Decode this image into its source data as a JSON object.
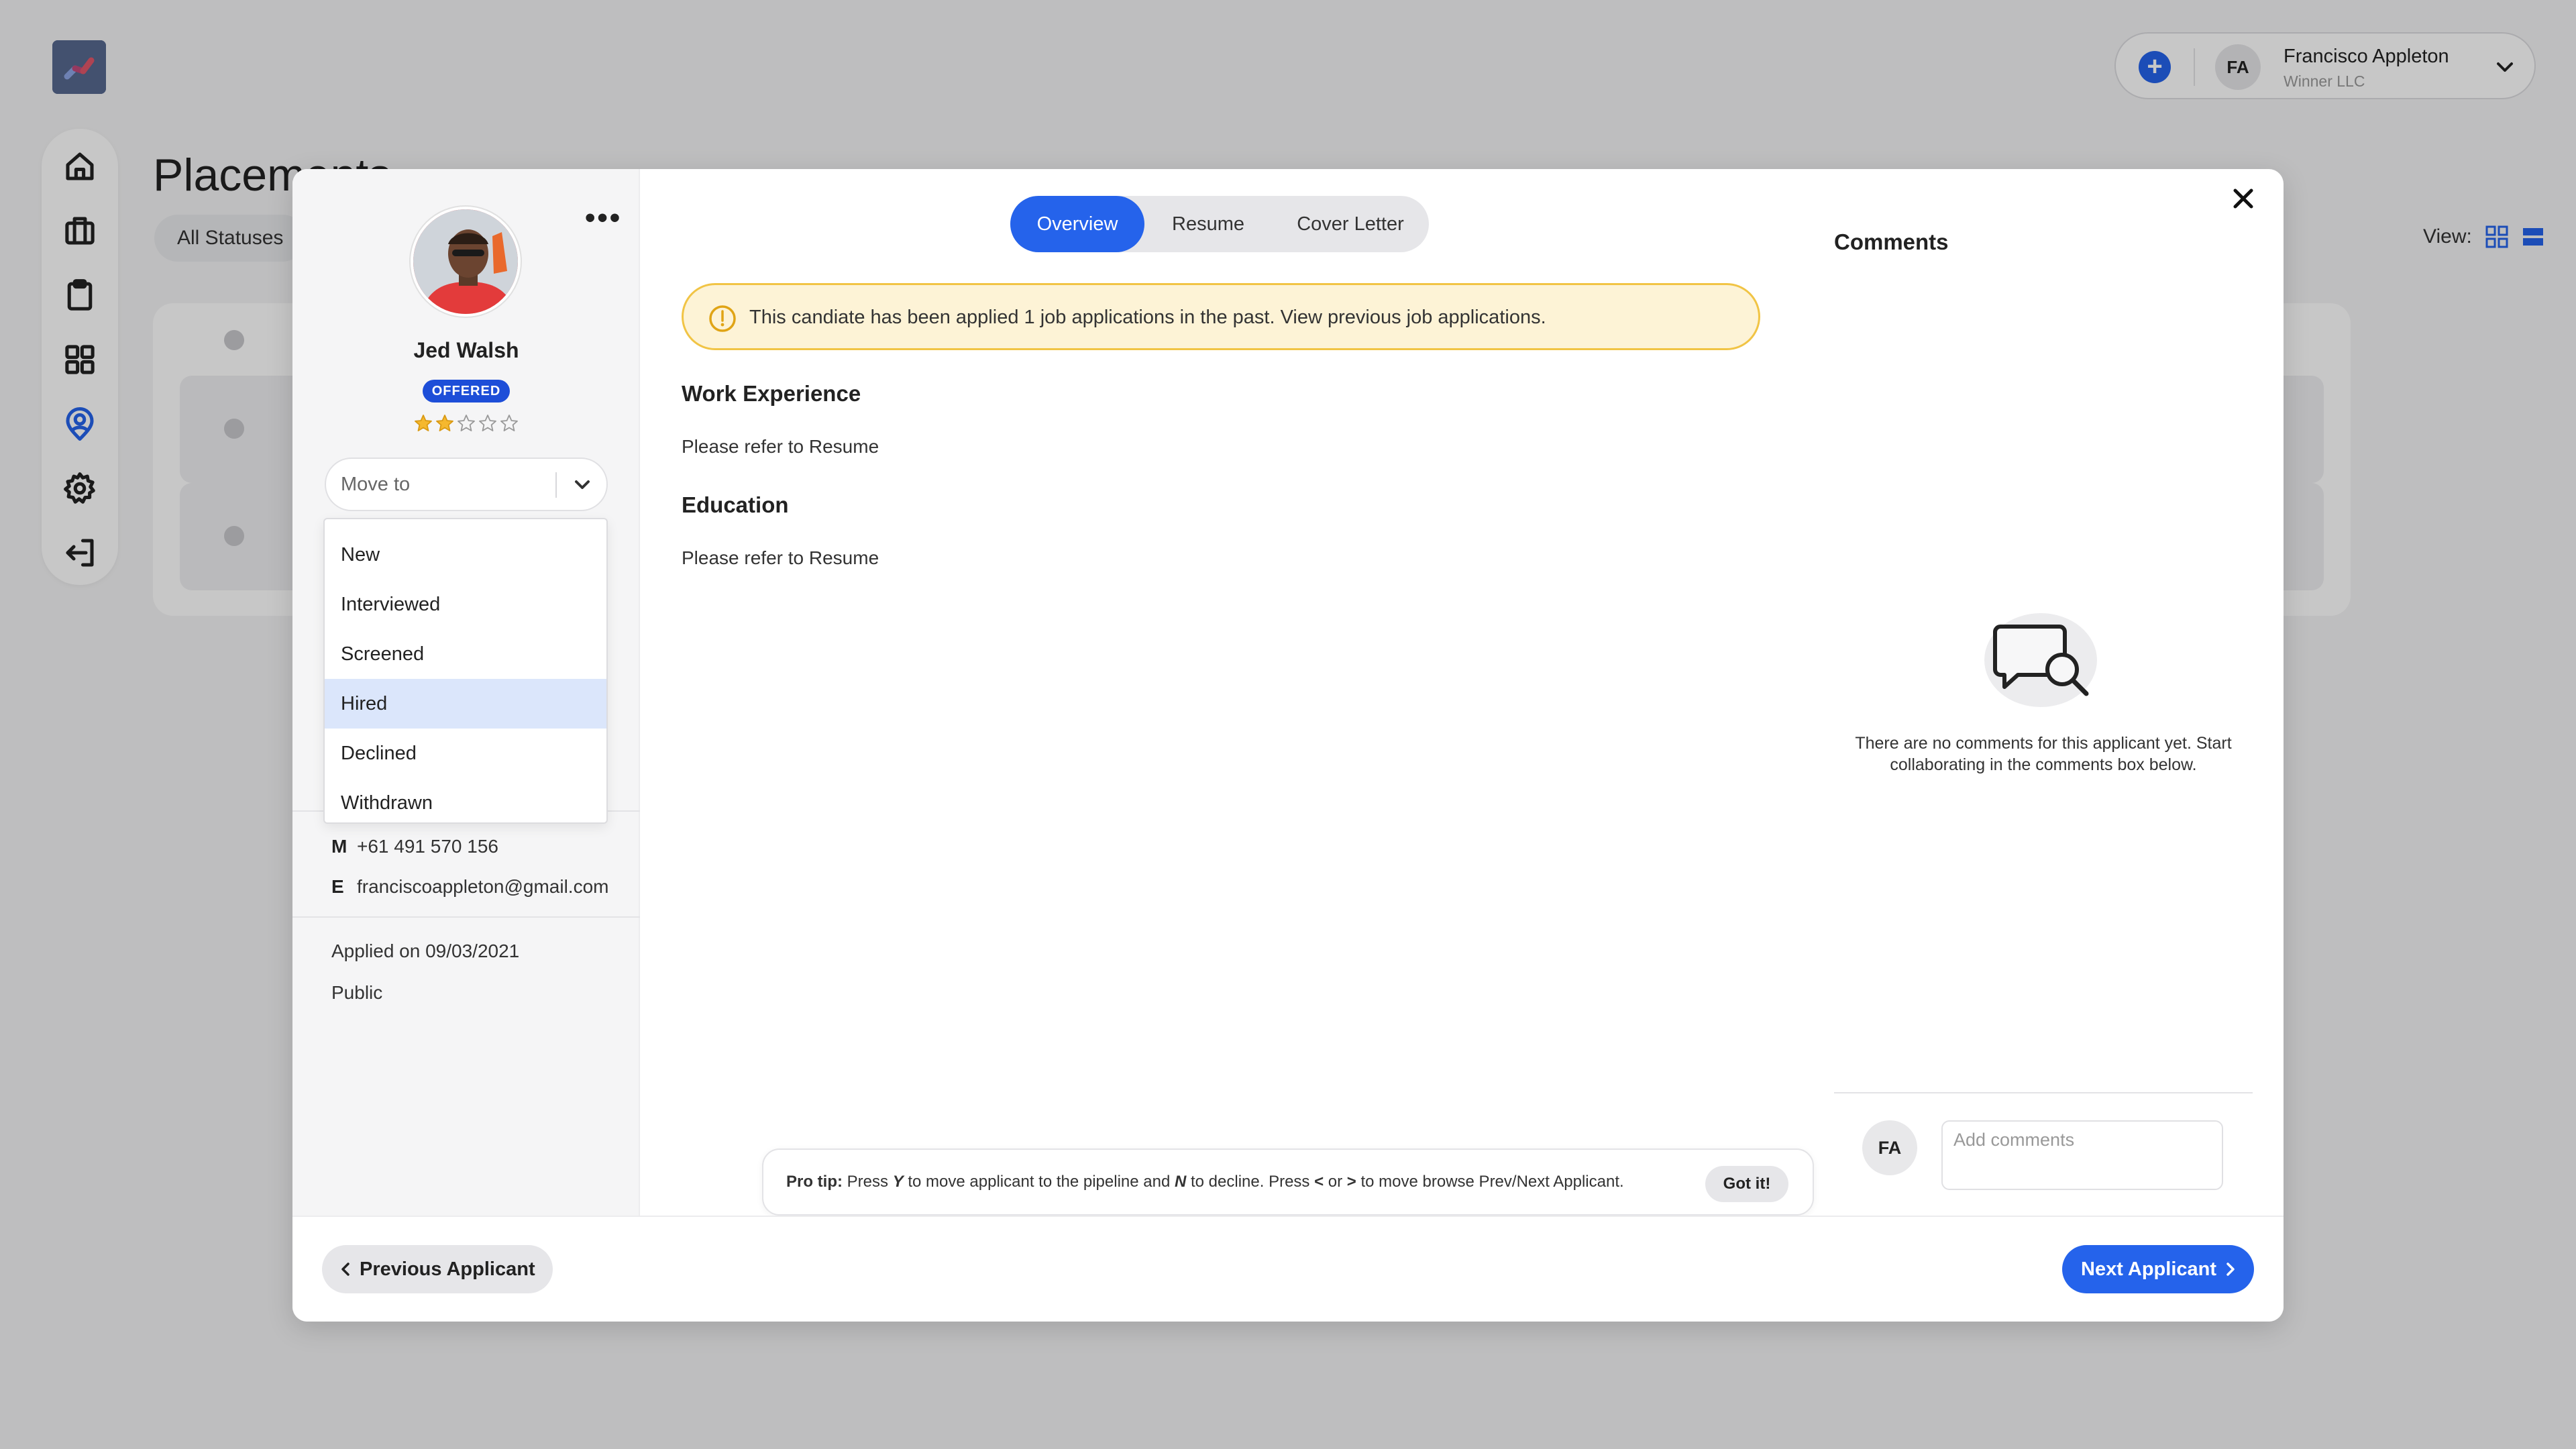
{
  "app": {
    "page_title": "Placements",
    "filter_label": "All Statuses",
    "view_label": "View:",
    "user": {
      "initials": "FA",
      "name": "Francisco Appleton",
      "company": "Winner LLC"
    }
  },
  "candidate": {
    "name": "Jed Walsh",
    "status": "OFFERED",
    "rating": 2,
    "rating_max": 5,
    "move_to_placeholder": "Move to",
    "move_options": [
      "New",
      "Interviewed",
      "Screened",
      "Hired",
      "Declined",
      "Withdrawn"
    ],
    "highlighted_option": "Hired",
    "mobile_label": "M",
    "mobile": "+61 491 570 156",
    "email_label": "E",
    "email": "franciscoappleton@gmail.com",
    "applied": "Applied on 09/03/2021",
    "visibility": "Public"
  },
  "tabs": [
    "Overview",
    "Resume",
    "Cover Letter"
  ],
  "active_tab": "Overview",
  "notice": "This candiate has been applied 1 job applications in the past. View previous job applications.",
  "sections": {
    "work_title": "Work Experience",
    "work_body": "Please refer to Resume",
    "edu_title": "Education",
    "edu_body": "Please refer to Resume"
  },
  "protip": {
    "lead": "Pro tip:",
    "t1": " Press ",
    "k1": "Y",
    "t2": " to move applicant to the pipeline and ",
    "k2": "N",
    "t3": " to decline. Press ",
    "k3": "<",
    "t4": " or ",
    "k4": ">",
    "t5": " to move browse Prev/Next Applicant.",
    "button": "Got it!"
  },
  "comments": {
    "title": "Comments",
    "empty": "There are no comments for this applicant yet. Start collaborating in the comments box below.",
    "avatar_initials": "FA",
    "input_placeholder": "Add comments"
  },
  "footer": {
    "prev": "Previous Applicant",
    "next": "Next Applicant"
  },
  "colors": {
    "accent": "#2563eb",
    "badge": "#1d4ed8",
    "notice_bg": "#fdf3d6",
    "notice_border": "#f1c445",
    "star": "#f5b82e",
    "highlight": "#dbe6fb"
  }
}
